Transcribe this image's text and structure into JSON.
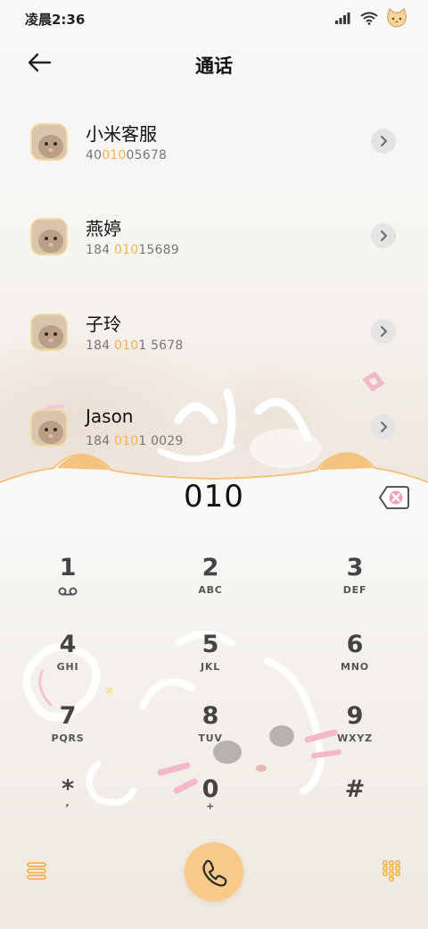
{
  "status_bar": {
    "time": "凌晨2:36",
    "icons": [
      "signal-icon",
      "wifi-icon",
      "cat-face-icon"
    ]
  },
  "header": {
    "title": "通话",
    "back_icon": "back-arrow-icon"
  },
  "contacts": [
    {
      "name": "小米客服",
      "number_pre": "40",
      "number_match": "010",
      "number_post": "05678"
    },
    {
      "name": "燕婷",
      "number_pre": "184 ",
      "number_match": "010",
      "number_post": "15689"
    },
    {
      "name": "子玲",
      "number_pre": "184 ",
      "number_match": "010",
      "number_post": "1 5678"
    },
    {
      "name": "Jason",
      "number_pre": "184 ",
      "number_match": "010",
      "number_post": "1 0029"
    }
  ],
  "dialer": {
    "entered_number": "010",
    "delete_icon": "backspace-icon",
    "keys": [
      {
        "digit": "1",
        "letters": ""
      },
      {
        "digit": "2",
        "letters": "ABC"
      },
      {
        "digit": "3",
        "letters": "DEF"
      },
      {
        "digit": "4",
        "letters": "GHI"
      },
      {
        "digit": "5",
        "letters": "JKL"
      },
      {
        "digit": "6",
        "letters": "MNO"
      },
      {
        "digit": "7",
        "letters": "PQRS"
      },
      {
        "digit": "8",
        "letters": "TUV"
      },
      {
        "digit": "9",
        "letters": "WXYZ"
      },
      {
        "digit": "*",
        "letters": ","
      },
      {
        "digit": "0",
        "letters": "+"
      },
      {
        "digit": "#",
        "letters": ""
      }
    ]
  },
  "bottom_bar": {
    "left_icon": "menu-icon",
    "call_icon": "phone-icon",
    "right_icon": "dialpad-icon"
  },
  "colors": {
    "accent": "#f7c98a",
    "match_highlight": "#f3b34c",
    "scallop": "#f6c37f"
  }
}
